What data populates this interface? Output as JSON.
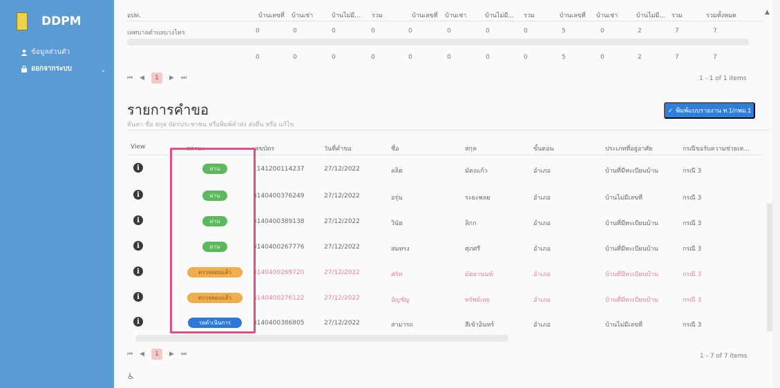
{
  "sidebar": {
    "brand": "DDPM",
    "items": [
      {
        "label": "ข้อมูลส่วนตัว"
      },
      {
        "label": "ออกจากระบบ"
      }
    ],
    "colors": {
      "bg": "#5b9bd3"
    }
  },
  "summary": {
    "headers": [
      "อปท.",
      "บ้านเลขที่",
      "บ้านเช่า",
      "บ้านไม่มี...",
      "รวม",
      "บ้านเลขที่",
      "บ้านเช่า",
      "บ้านไม่มี...",
      "รวม",
      "บ้านเลขที่",
      "บ้านเช่า",
      "บ้านไม่มี...",
      "รวม",
      "รวมทั้งหมด"
    ],
    "row": {
      "name": "เทศบาลตำบลบางไทร",
      "values": [
        "0",
        "0",
        "0",
        "0",
        "0",
        "0",
        "0",
        "0",
        "5",
        "0",
        "2",
        "7",
        "7"
      ]
    },
    "totals": [
      "0",
      "0",
      "0",
      "0",
      "0",
      "0",
      "0",
      "0",
      "5",
      "0",
      "2",
      "7",
      "7"
    ],
    "pager_current": "1",
    "items_text": "1 - 1 of 1 items"
  },
  "requests": {
    "title": "รายการคำขอ",
    "search_placeholder": "ค้นหา ชื่อ สกุล บัตรประชาชน หรือพิมพ์คำส่ง ส่งคืน หรือ แก้ไข",
    "export_label": "พิมพ์แบบรายงาน ท.1/กพม.1",
    "headers": [
      "View",
      "สถานะ",
      "เลขบัตร",
      "วันที่คำขอ",
      "ชื่อ",
      "สกุล",
      "ขั้นตอน",
      "ประเภทที่อยู่อาศัย",
      "กรณีขอรับความช่วยเห..."
    ],
    "rows": [
      {
        "status": "ผ่าน",
        "id": "1141200114237",
        "date": "27/12/2022",
        "first": "ลลิต",
        "last": "มัตงแก้ว",
        "step": "อำเภอ",
        "type": "บ้านที่มีทะเบียนบ้าน",
        "case": "กรณี 3"
      },
      {
        "status": "ผ่าน",
        "id": "3140400376249",
        "date": "27/12/2022",
        "first": "อรุ่น",
        "last": "ระยะพลย",
        "step": "อำเภอ",
        "type": "บ้านไม่มีเลขที่",
        "case": "กรณี 3"
      },
      {
        "status": "ผ่าน",
        "id": "3140400389138",
        "date": "27/12/2022",
        "first": "วินัย",
        "last": "ลิกก",
        "step": "อำเภอ",
        "type": "บ้านที่มีทะเบียนบ้าน",
        "case": "กรณี 3"
      },
      {
        "status": "ผ่าน",
        "id": "3140400267776",
        "date": "27/12/2022",
        "first": "สมทรง",
        "last": "ศุภศรี",
        "step": "อำเภอ",
        "type": "บ้านที่มีทะเบียนบ้าน",
        "case": "กรณี 3"
      },
      {
        "status": "ตรวจสอบแล้ว",
        "id": "3140400269720",
        "date": "27/12/2022",
        "first": "ศรัท",
        "last": "มัตยานนท์",
        "step": "อำเภอ",
        "type": "บ้านที่มีทะเบียนบ้าน",
        "case": "กรณี 3"
      },
      {
        "status": "ตรวจสอบแล้ว",
        "id": "3140400276122",
        "date": "27/12/2022",
        "first": "อัญชัญ",
        "last": "ทรัพย์เลย",
        "step": "อำเภอ",
        "type": "บ้านที่มีทะเบียนบ้าน",
        "case": "กรณี 3"
      },
      {
        "status": "รอดำเนินการ",
        "id": "3140400386805",
        "date": "27/12/2022",
        "first": "สามารถ",
        "last": "สีเข้าอินทร์",
        "step": "อำเภอ",
        "type": "บ้านไม่มีเลขที่",
        "case": "กรณี 3"
      }
    ],
    "pager_current": "1",
    "items_text": "1 - 7 of 7 items"
  },
  "colors": {
    "pass": "#5cb85c",
    "checked": "#f0ad4e",
    "pending": "#2e78d6",
    "highlight": "#e0507a"
  }
}
